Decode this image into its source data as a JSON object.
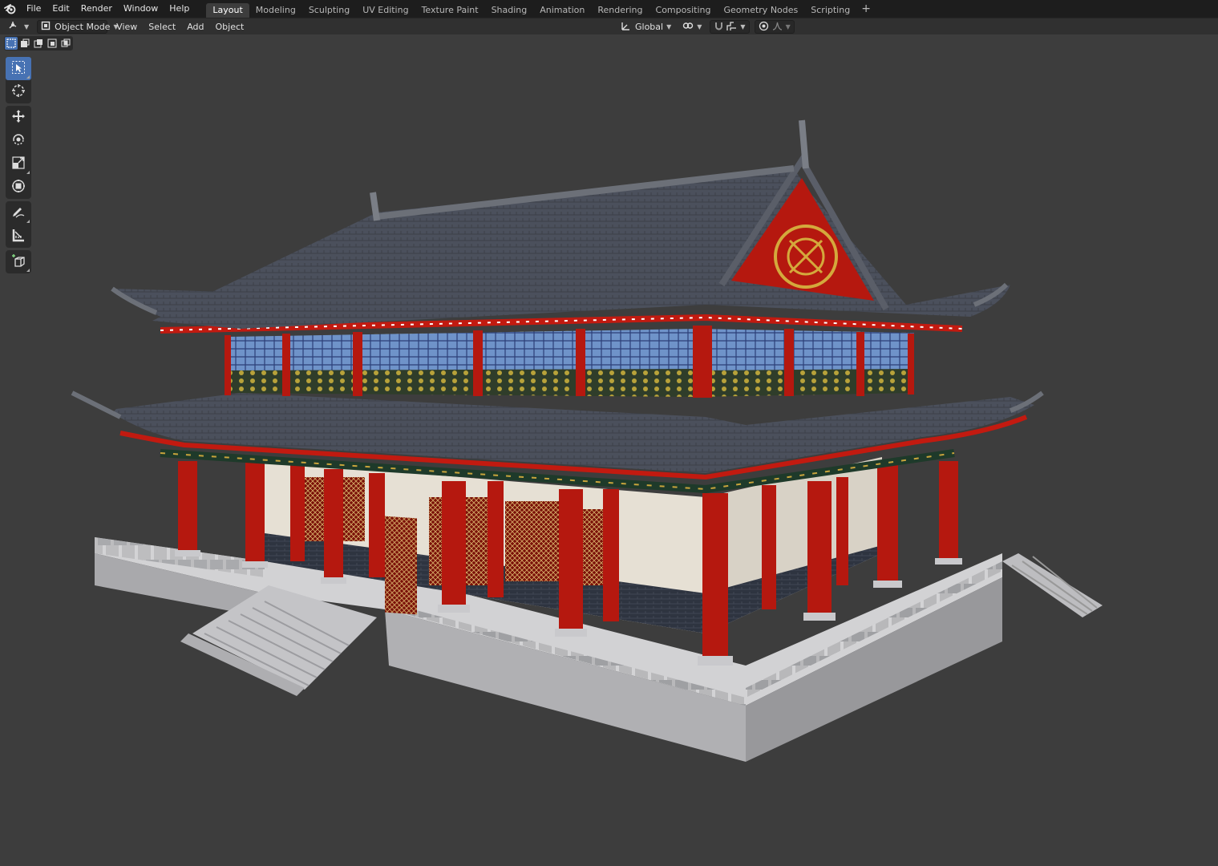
{
  "menubar": {
    "items": [
      "File",
      "Edit",
      "Render",
      "Window",
      "Help"
    ]
  },
  "workspaces": {
    "tabs": [
      "Layout",
      "Modeling",
      "Sculpting",
      "UV Editing",
      "Texture Paint",
      "Shading",
      "Animation",
      "Rendering",
      "Compositing",
      "Geometry Nodes",
      "Scripting"
    ],
    "active": "Layout",
    "add_label": "+"
  },
  "header": {
    "mode": "Object Mode",
    "menus": [
      "View",
      "Select",
      "Add",
      "Object"
    ],
    "transform_orientation": "Global"
  },
  "toolbar": {
    "tools": [
      "select-box-tool",
      "cursor-tool",
      "move-tool",
      "rotate-tool",
      "scale-tool",
      "transform-tool",
      "annotate-tool",
      "measure-tool",
      "add-cube-tool"
    ],
    "active_tool": "select-box-tool"
  },
  "colors": {
    "topbar": "#1d1d1d",
    "header": "#303030",
    "viewport": "#3d3d3d",
    "accent": "#4772b3",
    "roof": "#4a4f5a",
    "pillar": "#b5180f",
    "wall": "#e8e2d6",
    "platform": "#c9c9cb"
  }
}
